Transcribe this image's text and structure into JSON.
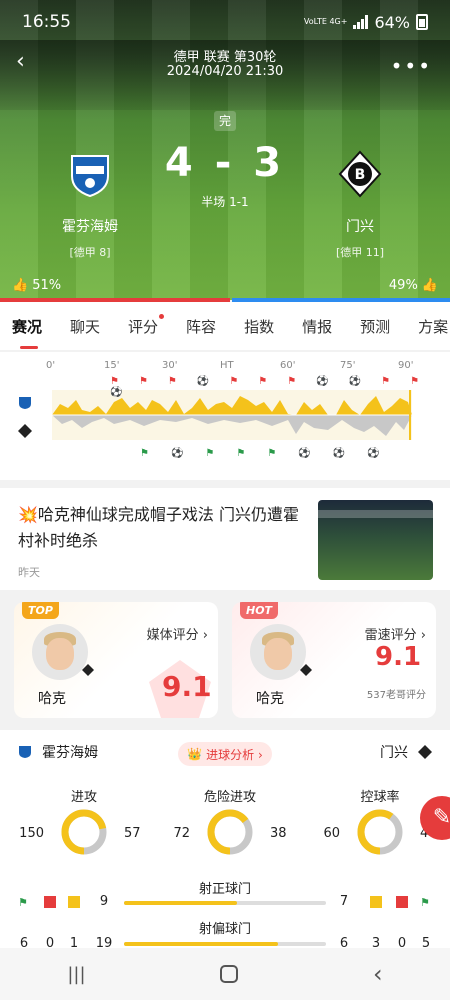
{
  "status_bar": {
    "time": "16:55",
    "network": "VoLTE 4G+",
    "battery": "64%"
  },
  "header": {
    "league_round": "德甲 联赛 第30轮",
    "datetime": "2024/04/20 21:30",
    "status": "完",
    "home": {
      "name": "霍芬海姆",
      "rank": "[德甲 8]"
    },
    "away": {
      "name": "门兴",
      "rank": "[德甲 11]"
    },
    "score_home": "4",
    "score_sep": "-",
    "score_away": "3",
    "halftime": "半场 1-1",
    "vote_home": "51%",
    "vote_away": "49%",
    "vote_home_fraction": 0.51
  },
  "tabs": [
    "赛况",
    "聊天",
    "评分",
    "阵容",
    "指数",
    "情报",
    "预测",
    "方案"
  ],
  "timeline": {
    "ticks": [
      "0'",
      "15'",
      "30'",
      "HT",
      "60'",
      "75'",
      "90'"
    ]
  },
  "article": {
    "emoji": "💥",
    "title": "哈克神仙球完成帽子戏法 门兴仍遭霍村补时绝杀",
    "time": "昨天"
  },
  "ratings": {
    "media": {
      "tag": "TOP",
      "label": "媒体评分 ›",
      "player": "哈克",
      "score": "9.1"
    },
    "leisu": {
      "tag": "HOT",
      "label": "雷速评分 ›",
      "player": "哈克",
      "score": "9.1",
      "sub": "537老哥评分"
    }
  },
  "stats": {
    "home_name": "霍芬海姆",
    "away_name": "门兴",
    "goal_analysis": "进球分析 ›",
    "donuts": [
      {
        "label": "进攻",
        "home": "150",
        "away": "57",
        "home_frac": 0.72
      },
      {
        "label": "危险进攻",
        "home": "72",
        "away": "38",
        "home_frac": 0.65
      },
      {
        "label": "控球率",
        "home": "60",
        "away": "40",
        "home_frac": 0.6
      }
    ],
    "shots_on": {
      "label": "射正球门",
      "home": "9",
      "away": "7",
      "home_frac": 0.56
    },
    "shots_off": {
      "label": "射偏球门",
      "home": "19",
      "away": "6",
      "home_frac": 0.76
    },
    "home_corners": "6",
    "home_red": "0",
    "home_yellow": "1",
    "away_corners": "3",
    "away_red": "0",
    "away_yellow": "5",
    "colors": {
      "home": "#f4c21b",
      "away": "#c8c8c8",
      "accent": "#e53c3c"
    }
  }
}
